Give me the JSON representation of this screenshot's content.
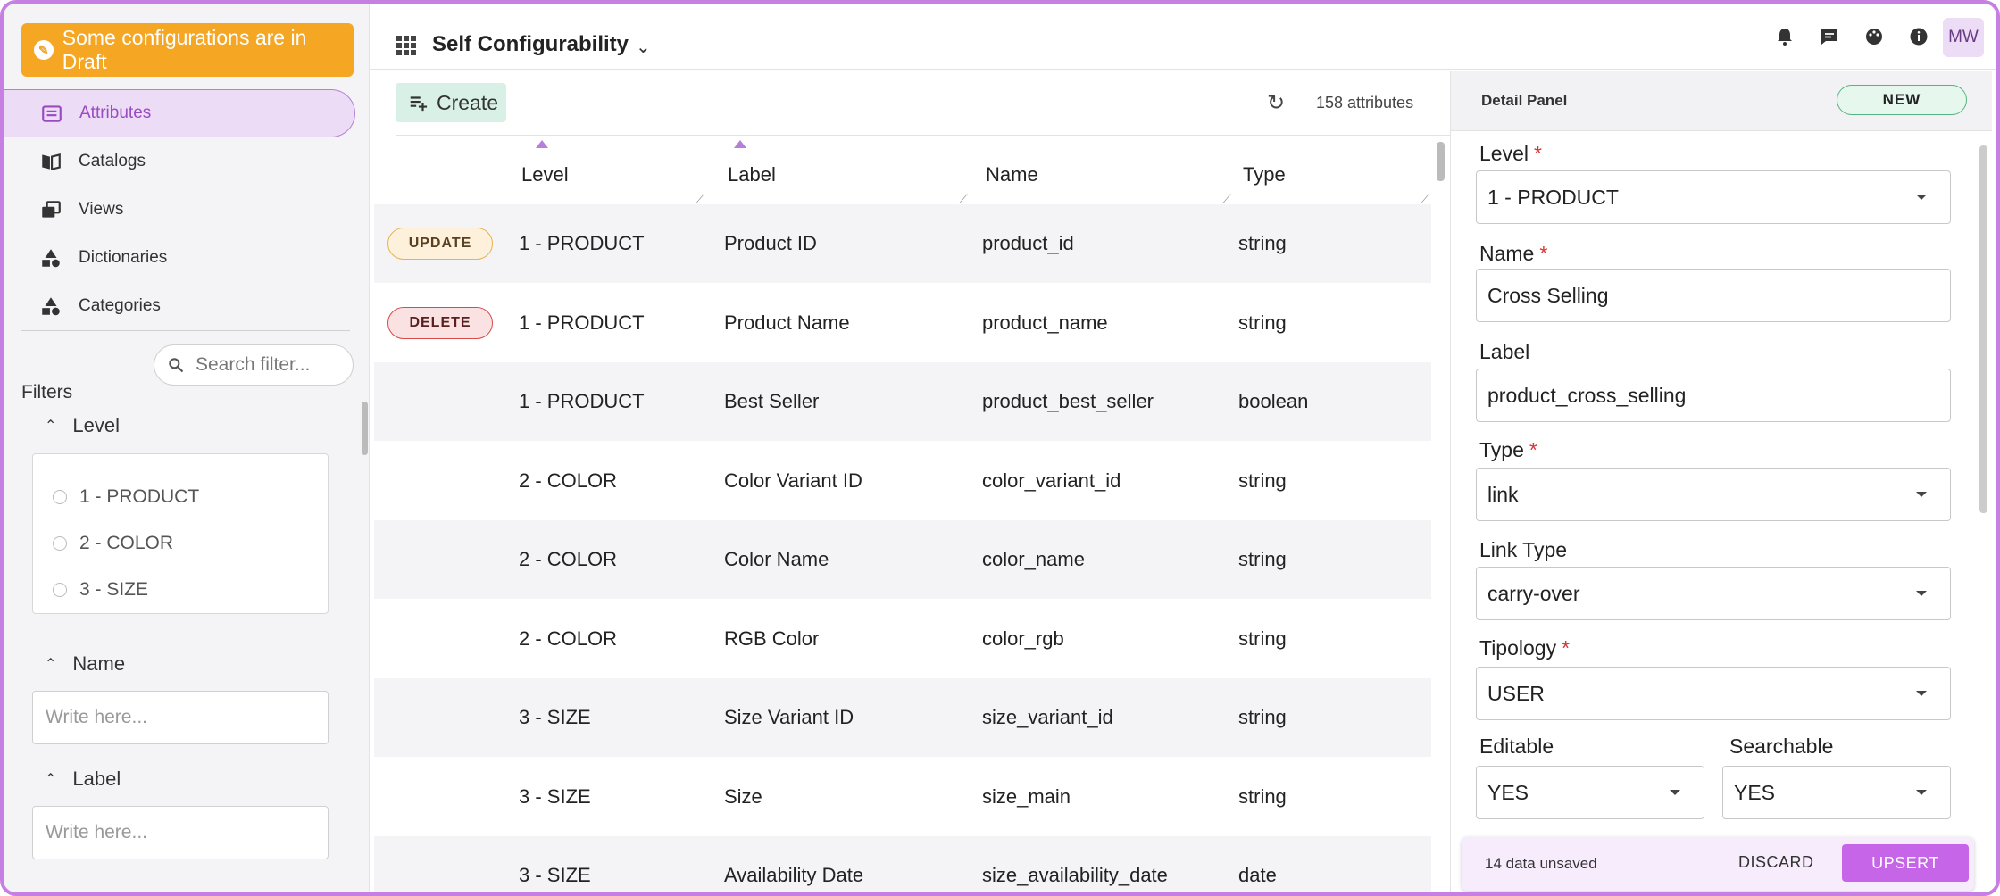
{
  "sidebar": {
    "draft_label": "Some configurations are in Draft",
    "nav": [
      {
        "label": "Attributes",
        "icon": "list-icon",
        "active": true
      },
      {
        "label": "Catalogs",
        "icon": "book-icon"
      },
      {
        "label": "Views",
        "icon": "views-icon"
      },
      {
        "label": "Dictionaries",
        "icon": "shapes-icon"
      },
      {
        "label": "Categories",
        "icon": "shapes-icon"
      }
    ],
    "search_placeholder": "Search filter...",
    "filters_title": "Filters",
    "level_filter": {
      "title": "Level",
      "options": [
        "1 - PRODUCT",
        "2 - COLOR",
        "3 - SIZE"
      ]
    },
    "name_filter": {
      "title": "Name",
      "placeholder": "Write here..."
    },
    "label_filter": {
      "title": "Label",
      "placeholder": "Write here..."
    }
  },
  "topbar": {
    "app_title": "Self Configurability",
    "avatar": "MW"
  },
  "main": {
    "create_label": "Create",
    "count": "158 attributes",
    "columns": [
      "Level",
      "Label",
      "Name",
      "Type"
    ],
    "rows": [
      {
        "badge": "UPDATE",
        "badge_type": "update",
        "level": "1 - PRODUCT",
        "label": "Product ID",
        "name": "product_id",
        "type": "string"
      },
      {
        "badge": "DELETE",
        "badge_type": "delete",
        "level": "1 - PRODUCT",
        "label": "Product Name",
        "name": "product_name",
        "type": "string"
      },
      {
        "badge": "",
        "badge_type": "",
        "level": "1 - PRODUCT",
        "label": "Best Seller",
        "name": "product_best_seller",
        "type": "boolean"
      },
      {
        "badge": "",
        "badge_type": "",
        "level": "2 - COLOR",
        "label": "Color Variant ID",
        "name": "color_variant_id",
        "type": "string"
      },
      {
        "badge": "",
        "badge_type": "",
        "level": "2 - COLOR",
        "label": "Color Name",
        "name": "color_name",
        "type": "string"
      },
      {
        "badge": "",
        "badge_type": "",
        "level": "2 - COLOR",
        "label": "RGB Color",
        "name": "color_rgb",
        "type": "string"
      },
      {
        "badge": "",
        "badge_type": "",
        "level": "3 - SIZE",
        "label": "Size Variant ID",
        "name": "size_variant_id",
        "type": "string"
      },
      {
        "badge": "",
        "badge_type": "",
        "level": "3 - SIZE",
        "label": "Size",
        "name": "size_main",
        "type": "string"
      },
      {
        "badge": "",
        "badge_type": "",
        "level": "3 - SIZE",
        "label": "Availability Date",
        "name": "size_availability_date",
        "type": "date"
      }
    ]
  },
  "panel": {
    "title": "Detail Panel",
    "status": "NEW",
    "fields": {
      "level": {
        "label": "Level",
        "value": "1 - PRODUCT"
      },
      "name": {
        "label": "Name",
        "value": "Cross Selling"
      },
      "label": {
        "label": "Label",
        "value": "product_cross_selling"
      },
      "type": {
        "label": "Type",
        "value": "link"
      },
      "link_type": {
        "label": "Link Type",
        "value": "carry-over"
      },
      "tipology": {
        "label": "Tipology",
        "value": "USER"
      },
      "editable": {
        "label": "Editable",
        "value": "YES"
      },
      "searchable": {
        "label": "Searchable",
        "value": "YES"
      }
    }
  },
  "unsaved": {
    "text": "14 data unsaved",
    "discard": "DISCARD",
    "upsert": "UPSERT"
  }
}
